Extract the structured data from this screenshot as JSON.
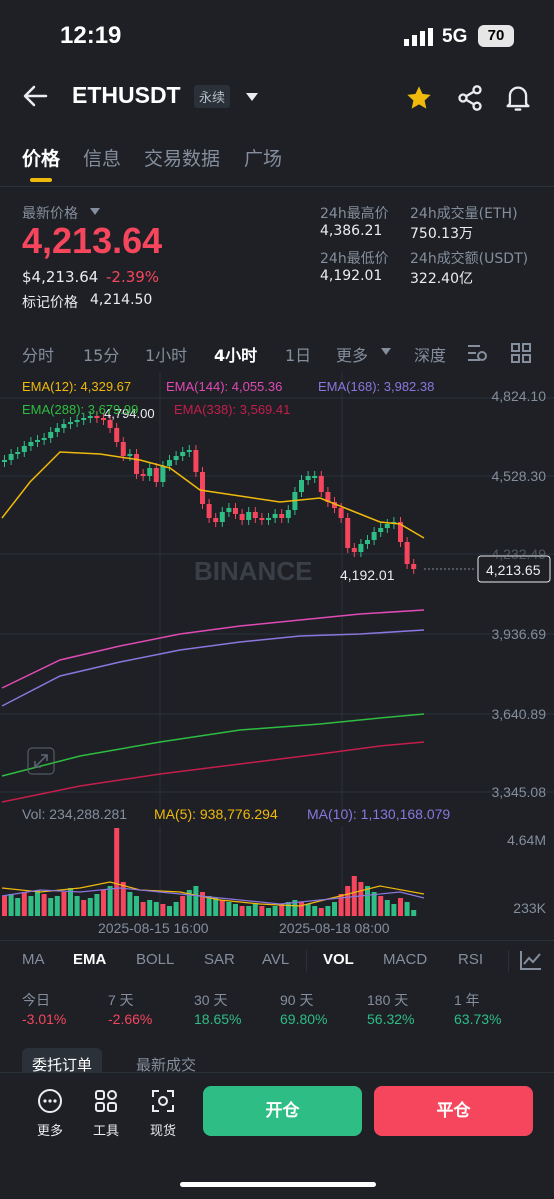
{
  "status": {
    "time": "12:19",
    "network": "5G",
    "battery": "70"
  },
  "header": {
    "symbol": "ETHUSDT",
    "contract_type": "永续"
  },
  "tabs": [
    {
      "label": "价格"
    },
    {
      "label": "信息"
    },
    {
      "label": "交易数据"
    },
    {
      "label": "广场"
    }
  ],
  "price": {
    "latest_label": "最新价格",
    "latest": "4,213.64",
    "usd_value": "$4,213.64",
    "change_pct": "-2.39%",
    "mark_label": "标记价格",
    "mark_value": "4,214.50"
  },
  "stats": {
    "high_label": "24h最高价",
    "high": "4,386.21",
    "low_label": "24h最低价",
    "low": "4,192.01",
    "vol_eth_label": "24h成交量(ETH)",
    "vol_eth": "750.13万",
    "vol_usdt_label": "24h成交额(USDT)",
    "vol_usdt": "322.40亿"
  },
  "intervals": [
    {
      "label": "分时"
    },
    {
      "label": "15分"
    },
    {
      "label": "1小时"
    },
    {
      "label": "4小时"
    },
    {
      "label": "1日"
    },
    {
      "label": "更多"
    },
    {
      "label": "深度"
    }
  ],
  "ema_legend": {
    "ema12": "EMA(12): 4,329.67",
    "ema144": "EMA(144): 4,055.36",
    "ema168": "EMA(168): 3,982.38",
    "ema288": "EMA(288): 3,679.99",
    "ema338": "EMA(338): 3,569.41"
  },
  "price_axis": [
    "4,824.10",
    "4,528.30",
    "4,232.49",
    "3,936.69",
    "3,640.89",
    "3,345.08"
  ],
  "current_price_tag": "4,213.65",
  "chart_high_label": "4,794.00",
  "chart_low_label": "4,192.01",
  "watermark": "BINANCE",
  "volume_legend": {
    "vol": "Vol: 234,288.281",
    "ma5": "MA(5): 938,776.294",
    "ma10": "MA(10): 1,130,168.079"
  },
  "volume_axis": [
    "4.64M",
    "233K"
  ],
  "time_axis": [
    "2025-08-15 16:00",
    "2025-08-18 08:00"
  ],
  "indicator_tabs": [
    {
      "label": "MA"
    },
    {
      "label": "EMA"
    },
    {
      "label": "BOLL"
    },
    {
      "label": "SAR"
    },
    {
      "label": "AVL"
    },
    {
      "label": "VOL"
    },
    {
      "label": "MACD"
    },
    {
      "label": "RSI"
    }
  ],
  "performance": [
    {
      "period": "今日",
      "value": "-3.01%"
    },
    {
      "period": "7 天",
      "value": "-2.66%"
    },
    {
      "period": "30 天",
      "value": "18.65%"
    },
    {
      "period": "90 天",
      "value": "69.80%"
    },
    {
      "period": "180 天",
      "value": "56.32%"
    },
    {
      "period": "1 年",
      "value": "63.73%"
    }
  ],
  "order_tabs": [
    {
      "label": "委托订单"
    },
    {
      "label": "最新成交"
    }
  ],
  "bottom_bar": {
    "more": "更多",
    "tools": "工具",
    "spot": "现货",
    "open": "开仓",
    "close": "平仓"
  },
  "colors": {
    "up": "#2ebd85",
    "down": "#f6465d",
    "accent": "#f0b90b",
    "bg": "#1e2026"
  }
}
